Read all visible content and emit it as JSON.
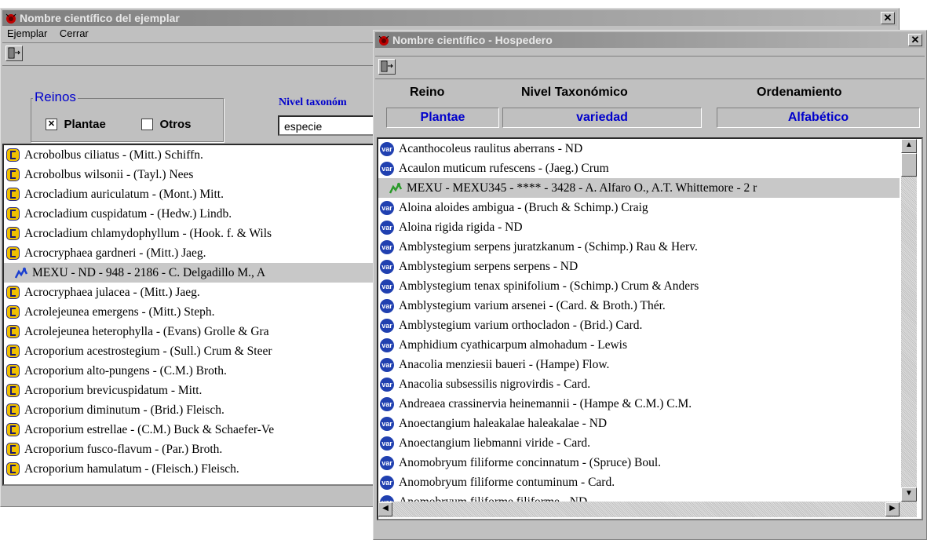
{
  "back_window": {
    "title": "Nombre científico del ejemplar",
    "menu": [
      "Ejemplar",
      "Cerrar"
    ],
    "reinos_label": "Reinos",
    "checkbox_plantae": {
      "label": "Plantae",
      "mark": "✕"
    },
    "checkbox_otros": {
      "label": "Otros"
    },
    "nivel_label": "Nivel taxonóm",
    "nivel_value": "especie",
    "items": [
      "Acrobolbus ciliatus - (Mitt.) Schiffn.",
      "Acrobolbus wilsonii - (Tayl.) Nees",
      "Acrocladium auriculatum  - (Mont.) Mitt.",
      "Acrocladium cuspidatum - (Hedw.) Lindb.",
      "Acrocladium chlamydophyllum - (Hook. f. & Wils",
      "Acrocryphaea gardneri - (Mitt.) Jaeg.",
      "MEXU - ND - 948 -  2186 - C. Delgadillo M., A",
      "Acrocryphaea julacea - (Mitt.) Jaeg.",
      "Acrolejeunea emergens - (Mitt.) Steph.",
      "Acrolejeunea heterophylla - (Evans) Grolle & Gra",
      "Acroporium acestrostegium - (Sull.) Crum & Steer",
      "Acroporium alto-pungens - (C.M.) Broth.",
      "Acroporium brevicuspidatum - Mitt.",
      "Acroporium diminutum - (Brid.) Fleisch.",
      "Acroporium estrellae - (C.M.) Buck & Schaefer-Ve",
      "Acroporium fusco-flavum - (Par.) Broth.",
      "Acroporium hamulatum - (Fleisch.) Fleisch."
    ]
  },
  "front_window": {
    "title": "Nombre científico - Hospedero",
    "headers": {
      "reino": "Reino",
      "nivel": "Nivel Taxonómico",
      "orden": "Ordenamiento"
    },
    "values": {
      "reino": "Plantae",
      "nivel": "variedad",
      "orden": "Alfabético"
    },
    "var_icon_label": "var",
    "items": [
      "Acanthocoleus raulitus aberrans - ND",
      "Acaulon muticum rufescens - (Jaeg.) Crum",
      "MEXU - MEXU345 - **** -  3428 - A. Alfaro O., A.T. Whittemore - 2 r",
      "Aloina aloides ambigua - (Bruch & Schimp.) Craig",
      "Aloina rigida rigida - ND",
      "Amblystegium serpens juratzkanum - (Schimp.) Rau & Herv.",
      "Amblystegium serpens serpens - ND",
      "Amblystegium tenax spinifolium - (Schimp.) Crum & Anders",
      "Amblystegium varium arsenei - (Card. & Broth.) Thér.",
      "Amblystegium varium orthocladon - (Brid.) Card.",
      "Amphidium cyathicarpum almohadum - Lewis",
      "Anacolia menziesii baueri - (Hampe) Flow.",
      "Anacolia subsessilis nigrovirdis - Card.",
      "Andreaea crassinervia heinemannii - (Hampe & C.M.) C.M.",
      "Anoectangium haleakalae haleakalae - ND",
      "Anoectangium liebmanni viride - Card.",
      "Anomobryum filiforme concinnatum - (Spruce) Boul.",
      "Anomobryum filiforme contuminum - Card.",
      "Anomobryum filiforme filiforme - ND"
    ]
  },
  "colors": {
    "accent_blue": "#0000cc",
    "title_gray": "#8a8a8a"
  }
}
